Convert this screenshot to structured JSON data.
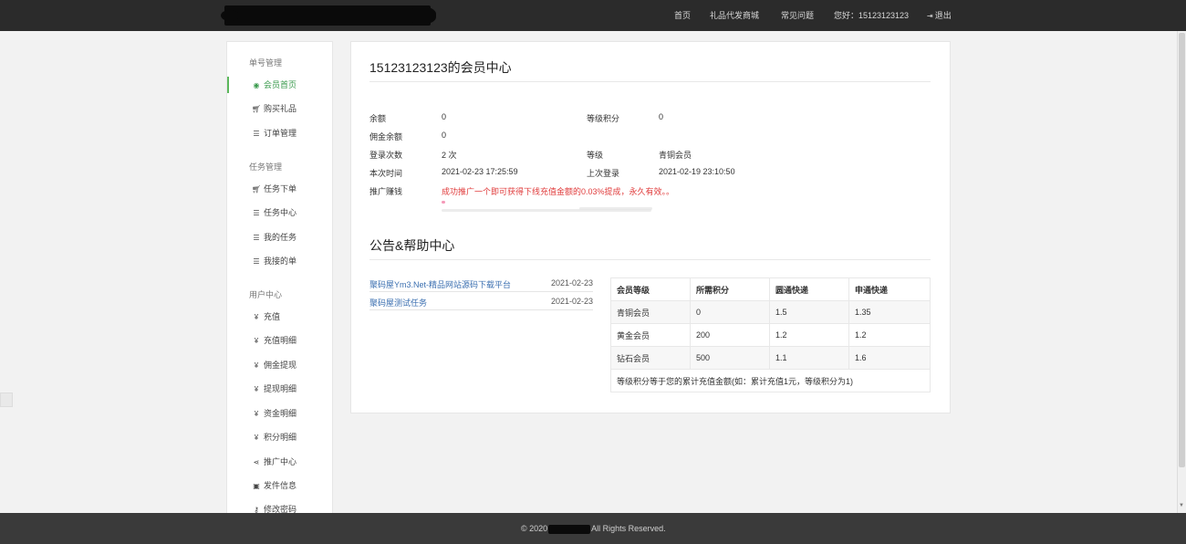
{
  "nav": {
    "home": "首页",
    "mall": "礼品代发商城",
    "faq": "常见问题",
    "greeting": "您好：15123123123",
    "logout": "退出"
  },
  "sidebar": {
    "sections": [
      {
        "title": "单号管理",
        "items": [
          {
            "label": "会员首页",
            "icon": "user-circle-icon",
            "active": true
          },
          {
            "label": "购买礼品",
            "icon": "cart-icon"
          },
          {
            "label": "订单管理",
            "icon": "list-icon"
          }
        ]
      },
      {
        "title": "任务管理",
        "items": [
          {
            "label": "任务下单",
            "icon": "cart-icon"
          },
          {
            "label": "任务中心",
            "icon": "list-icon"
          },
          {
            "label": "我的任务",
            "icon": "list-icon"
          },
          {
            "label": "我接的单",
            "icon": "list-icon"
          }
        ]
      },
      {
        "title": "用户中心",
        "items": [
          {
            "label": "充值",
            "icon": "yen-icon"
          },
          {
            "label": "充值明细",
            "icon": "yen-icon"
          },
          {
            "label": "佣金提现",
            "icon": "yen-icon"
          },
          {
            "label": "提现明细",
            "icon": "yen-icon"
          },
          {
            "label": "资金明细",
            "icon": "yen-icon"
          },
          {
            "label": "积分明细",
            "icon": "yen-icon"
          },
          {
            "label": "推广中心",
            "icon": "share-icon"
          },
          {
            "label": "发件信息",
            "icon": "id-card-icon"
          },
          {
            "label": "修改密码",
            "icon": "key-icon"
          }
        ]
      }
    ]
  },
  "member": {
    "title": "15123123123的会员中心",
    "balance_label": "余额",
    "balance": "0",
    "level_points_label": "等级积分",
    "level_points": "0",
    "commission_label": "佣金余额",
    "commission": "0",
    "login_count_label": "登录次数",
    "login_count": "2 次",
    "level_label": "等级",
    "level": "青铜会员",
    "this_time_label": "本次时间",
    "this_time": "2021-02-23 17:25:59",
    "last_login_label": "上次登录",
    "last_login": "2021-02-19 23:10:50",
    "promo_label": "推广赚钱",
    "promo_text": "成功推广一个即可获得下线充值金额的0.03%提成，永久有效。。"
  },
  "help": {
    "title": "公告&帮助中心",
    "notices": [
      {
        "title": "聚码屋Ym3.Net-精品网站源码下载平台",
        "date": "2021-02-23"
      },
      {
        "title": "聚码屋测试任务",
        "date": "2021-02-23"
      }
    ],
    "table": {
      "headers": [
        "会员等级",
        "所需积分",
        "圆通快递",
        "申通快递"
      ],
      "rows": [
        [
          "青铜会员",
          "0",
          "1.5",
          "1.35"
        ],
        [
          "黄金会员",
          "200",
          "1.2",
          "1.2"
        ],
        [
          "钻石会员",
          "500",
          "1.1",
          "1.6"
        ]
      ],
      "note": "等级积分等于您的累计充值金额(如：累计充值1元，等级积分为1)"
    }
  },
  "footer": {
    "prefix": "© 2020",
    "suffix": "All Rights Reserved."
  },
  "colors": {
    "topbar": "#2b2b2b",
    "accent": "#5cb85c",
    "promo": "#e03c3c",
    "link": "#3b6fb0"
  }
}
